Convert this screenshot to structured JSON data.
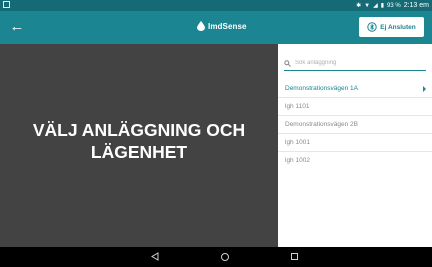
{
  "status_bar": {
    "time": "2:13 em",
    "battery": "93 %",
    "icons": [
      "notification-icon",
      "bluetooth-icon",
      "wifi-icon",
      "signal-icon",
      "battery-icon"
    ]
  },
  "app_bar": {
    "back_icon": "arrow-left-icon",
    "logo_text": "ImdSense",
    "connect_label": "Ej Ansluten",
    "colors": {
      "primary": "#1b8591",
      "status": "#146b75"
    }
  },
  "left_panel": {
    "title_line1": "VÄLJ ANLÄGGNING OCH",
    "title_line2": "LÄGENHET",
    "background": "#434343"
  },
  "search": {
    "placeholder": "Sök anläggning",
    "value": ""
  },
  "list": {
    "items": [
      {
        "label": "Demonstrationsvägen 1A",
        "active": true
      },
      {
        "label": "lgh 1101",
        "active": false
      },
      {
        "label": "Demonstrationsvägen 2B",
        "active": false
      },
      {
        "label": "lgh 1001",
        "active": false
      },
      {
        "label": "lgh 1002",
        "active": false
      }
    ]
  },
  "nav_bar": {
    "icons": [
      "nav-back-icon",
      "nav-home-icon",
      "nav-recent-apps-icon"
    ]
  }
}
